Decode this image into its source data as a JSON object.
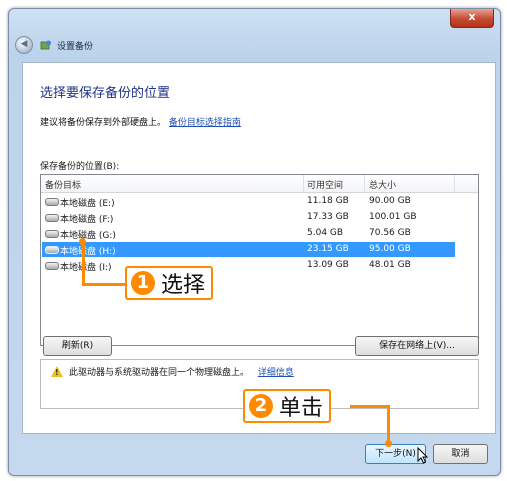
{
  "window": {
    "title": "设置备份",
    "close_glyph": "x",
    "back_glyph": "◀"
  },
  "page": {
    "heading": "选择要保存备份的位置",
    "subtitle": "建议将备份保存到外部硬盘上。",
    "help_link": "备份目标选择指南",
    "location_label": "保存备份的位置(B):"
  },
  "table": {
    "columns": [
      "备份目标",
      "可用空间",
      "总大小"
    ],
    "rows": [
      {
        "name": "本地磁盘 (E:)",
        "free": "11.18 GB",
        "total": "90.00 GB",
        "selected": false
      },
      {
        "name": "本地磁盘 (F:)",
        "free": "17.33 GB",
        "total": "100.01 GB",
        "selected": false
      },
      {
        "name": "本地磁盘 (G:)",
        "free": "5.04 GB",
        "total": "70.56 GB",
        "selected": false
      },
      {
        "name": "本地磁盘 (H:)",
        "free": "23.15 GB",
        "total": "95.00 GB",
        "selected": true
      },
      {
        "name": "本地磁盘 (I:)",
        "free": "13.09 GB",
        "total": "48.01 GB",
        "selected": false
      }
    ]
  },
  "buttons": {
    "refresh": "刷新(R)",
    "save_network": "保存在网络上(V)...",
    "next": "下一步(N)",
    "cancel": "取消"
  },
  "warning": {
    "text": "此驱动器与系统驱动器在同一个物理磁盘上。",
    "link": "详细信息"
  },
  "annotations": {
    "step1": {
      "number": "1",
      "text": "选择"
    },
    "step2": {
      "number": "2",
      "text": "单击"
    }
  },
  "colors": {
    "accent_orange": "#ff8a00",
    "selection_blue": "#3399ff",
    "heading_blue": "#1e3287"
  }
}
